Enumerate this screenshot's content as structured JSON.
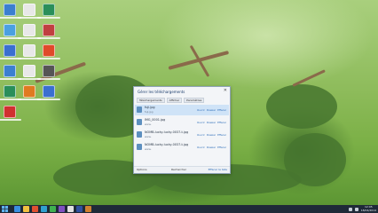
{
  "desktop": {
    "icons": [
      {
        "name": "desktop-icon-1",
        "color": "#3b7fd0"
      },
      {
        "name": "desktop-icon-2",
        "color": "#e8e8e8"
      },
      {
        "name": "desktop-icon-3",
        "color": "#2a8f5a"
      },
      {
        "name": "desktop-icon-4",
        "color": "#4aa0e0"
      },
      {
        "name": "desktop-icon-5",
        "color": "#e8e8e8"
      },
      {
        "name": "desktop-icon-6",
        "color": "#c04040"
      },
      {
        "name": "desktop-icon-7",
        "color": "#3a6fd0"
      },
      {
        "name": "desktop-icon-8",
        "color": "#e8e8e8"
      },
      {
        "name": "desktop-icon-9",
        "color": "#e04a2a"
      },
      {
        "name": "desktop-icon-10",
        "color": "#3b7fd0"
      },
      {
        "name": "desktop-icon-11",
        "color": "#e8e8e8"
      },
      {
        "name": "desktop-icon-12",
        "color": "#555555"
      },
      {
        "name": "desktop-icon-13",
        "color": "#2a8f5a"
      },
      {
        "name": "desktop-icon-14",
        "color": "#e07a20"
      },
      {
        "name": "desktop-icon-15",
        "color": "#3a6fd0"
      },
      {
        "name": "desktop-icon-16",
        "color": "#d03030"
      }
    ]
  },
  "dialog": {
    "title": "Gérer les téléchargements",
    "close": "✕",
    "tabs": [
      "Téléchargements",
      "Afficher",
      "Paramètres"
    ],
    "items": [
      {
        "name": "fuji.jpg",
        "sub": "fuji.jpg",
        "actions": [
          "Ouvrir",
          "Dossier",
          "Effacer"
        ],
        "selected": true
      },
      {
        "name": "IMG_0001.jpg",
        "sub": "www.",
        "actions": [
          "Ouvrir",
          "Dossier",
          "Effacer"
        ],
        "selected": false
      },
      {
        "name": "NOMB-lucky-lucky-0037-t.jpg",
        "sub": "www.",
        "actions": [
          "Ouvrir",
          "Dossier",
          "Effacer"
        ],
        "selected": false
      },
      {
        "name": "NOMB-lucky-lucky-0037-t.jpg",
        "sub": "www.",
        "actions": [
          "Ouvrir",
          "Dossier",
          "Effacer"
        ],
        "selected": false
      }
    ],
    "footer": {
      "left": "Options",
      "middle": "Rechercher",
      "right": "Effacer la liste"
    }
  },
  "taskbar": {
    "start_icon": "windows-logo-icon",
    "apps": [
      {
        "name": "ie-icon",
        "color": "#3a8fe0"
      },
      {
        "name": "explorer-icon",
        "color": "#f0c040"
      },
      {
        "name": "media-icon",
        "color": "#e05030"
      },
      {
        "name": "store-icon",
        "color": "#30a0d0"
      },
      {
        "name": "chrome-icon",
        "color": "#40b050"
      },
      {
        "name": "app-icon-6",
        "color": "#8050c0"
      },
      {
        "name": "app-icon-7",
        "color": "#e0e0e0"
      },
      {
        "name": "app-icon-8",
        "color": "#3050a0"
      },
      {
        "name": "app-icon-9",
        "color": "#d08030"
      }
    ],
    "clock_time": "12:05",
    "clock_date": "18/04/2014"
  }
}
